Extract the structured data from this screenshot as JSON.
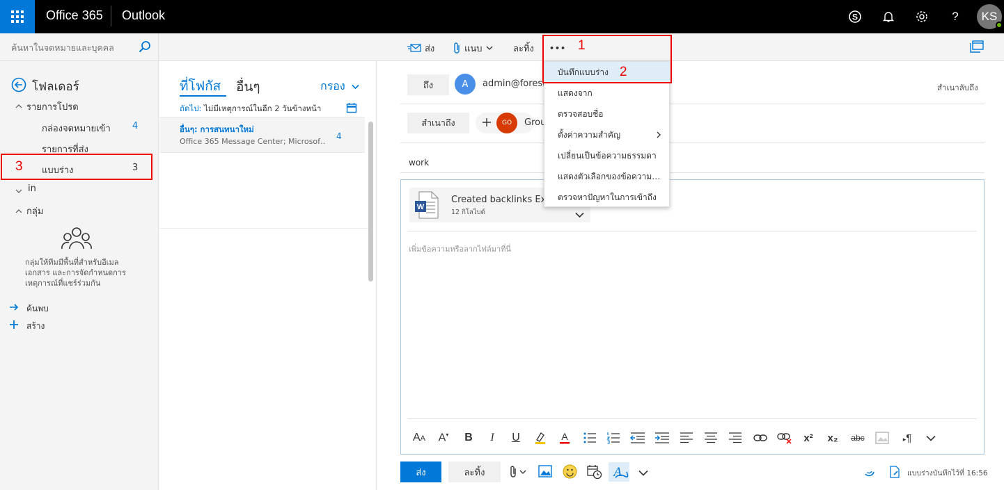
{
  "topbar": {
    "brand": "Office 365",
    "app": "Outlook",
    "avatar_initials": "KS"
  },
  "search": {
    "placeholder": "ค้นหาในจดหมายและบุคคล"
  },
  "commands": {
    "send": "ส่ง",
    "attach": "แนบ",
    "discard": "ละทิ้ง",
    "more": "•••"
  },
  "nav": {
    "folders_title": "โฟลเดอร์",
    "favorites": "รายการโปรด",
    "items": [
      {
        "label": "กล่องจดหมายเข้า",
        "count": "4"
      },
      {
        "label": "รายการที่ส่ง",
        "count": ""
      },
      {
        "label": "แบบร่าง",
        "count": "3"
      }
    ],
    "in_label": "in",
    "groups_title": "กลุ่ม",
    "groups_desc": "กลุ่มให้ทีมมีพื้นที่สำหรับอีเมล เอกสาร และการจัดกำหนดการ เหตุการณ์ที่แชร์ร่วมกัน",
    "discover": "ค้นพบ",
    "create": "สร้าง"
  },
  "msglist": {
    "tab_focused": "ที่โฟกัส",
    "tab_other": "อื่นๆ",
    "filter": "กรอง",
    "next_prefix": "ถัดไป:",
    "next_text": "ไม่มีเหตุการณ์ในอีก 2 วันข้างหน้า",
    "item": {
      "title": "อื่นๆ: การสนทนาใหม่",
      "preview": "Office 365 Message Center; Microsof…",
      "count": "4"
    }
  },
  "compose": {
    "to_label": "ถึง",
    "to_avatar": "A",
    "to_value": "admin@forest",
    "bcc_label": "สำเนาลับถึง",
    "cc_label": "สำเนาถึง",
    "cc_avatar": "GO",
    "cc_value": "Grou",
    "subject": "work",
    "attachment_name": "Created backlinks Exp",
    "attachment_size": "12 กิโลไบต์",
    "body_placeholder": "เพิ่มข้อความหรือลากไฟล์มาที่นี่",
    "send": "ส่ง",
    "discard": "ละทิ้ง",
    "saved_status": "แบบร่างบันทึกไว้ที่ 16:56"
  },
  "menu": {
    "items": [
      "บันทึกแบบร่าง",
      "แสดงจาก",
      "ตรวจสอบชื่อ",
      "ตั้งค่าความสำคัญ",
      "เปลี่ยนเป็นข้อความธรรมดา",
      "แสดงตัวเลือกของข้อความ…",
      "ตรวจหาปัญหาในการเข้าถึง"
    ]
  },
  "format": {
    "bold": "B",
    "italic": "I",
    "underline": "U",
    "strike": "abc",
    "superscript": "x²",
    "subscript": "x₂",
    "paragraph": "¶"
  },
  "annotations": {
    "step1": "1",
    "step2": "2",
    "step3": "3"
  },
  "colors": {
    "accent": "#0078d7",
    "highlight": "#e00000",
    "topbar": "#000000"
  }
}
